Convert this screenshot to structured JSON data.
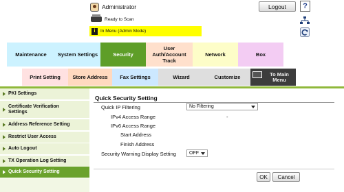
{
  "header": {
    "user": "Administrator",
    "logout_label": "Logout",
    "help_label": "?",
    "status_text": "Ready to Scan",
    "mode_text": "In Menu (Admin Mode)",
    "info_glyph": "i"
  },
  "main_tabs": [
    {
      "label": "Maintenance",
      "color": "#ccf2ff"
    },
    {
      "label": "System Settings",
      "color": "#ccf2ff"
    },
    {
      "label": "Security",
      "color": "#5e9e28",
      "active": true
    },
    {
      "label": "User Auth/Account Track",
      "color": "#ffe0cc"
    },
    {
      "label": "Network",
      "color": "#fdfdc8"
    },
    {
      "label": "Box",
      "color": "#f3ccf3"
    }
  ],
  "sub_tabs": [
    {
      "label": "Print Setting",
      "color": "#ffe1e1"
    },
    {
      "label": "Store Address",
      "color": "#ffd9bf"
    },
    {
      "label": "Fax Settings",
      "color": "#cce8ff"
    },
    {
      "label": "Wizard",
      "color": "#dedede"
    },
    {
      "label": "Customize",
      "color": "#dedede"
    },
    {
      "label": "To Main Menu",
      "color": "#3c3c3c"
    }
  ],
  "sidebar": {
    "items": [
      {
        "label": "PKI Settings"
      },
      {
        "label": "Certificate Verification Settings"
      },
      {
        "label": "Address Reference Setting"
      },
      {
        "label": "Restrict User Access"
      },
      {
        "label": "Auto Logout"
      },
      {
        "label": "TX Operation Log Setting"
      },
      {
        "label": "Quick Security Setting",
        "active": true
      }
    ]
  },
  "form": {
    "title": "Quick Security Setting",
    "ip_filtering_label": "Quick IP Filtering",
    "ip_filtering_value": "No Filtering",
    "ipv4_label": "IPv4 Access Range",
    "ipv4_value": "-",
    "ipv6_label": "IPv6 Access Range",
    "start_label": "Start Address",
    "finish_label": "Finish Address",
    "warning_label": "Security Warning Display Setting",
    "warning_value": "OFF",
    "ok_label": "OK",
    "cancel_label": "Cancel"
  },
  "colors": {
    "accent_green": "#6aa22c",
    "mode_bar": "#ffff00"
  }
}
